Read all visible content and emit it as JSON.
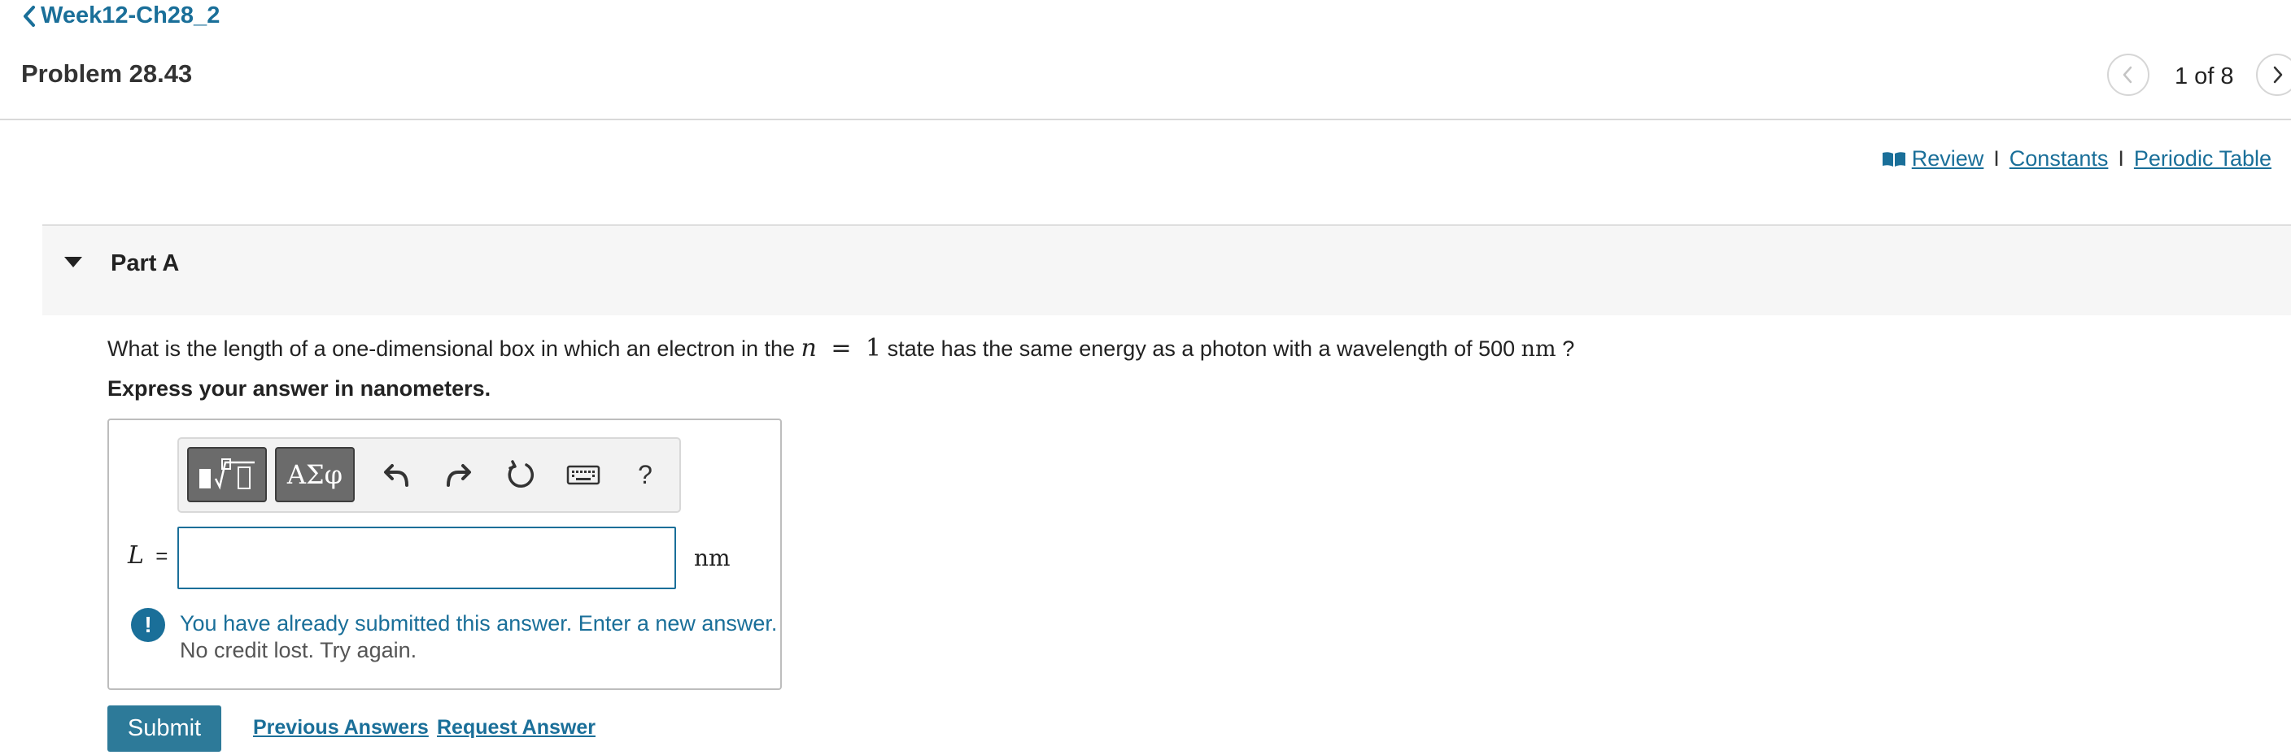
{
  "header": {
    "back_label": "Week12-Ch28_2",
    "problem_title": "Problem 28.43",
    "pager_text": "1 of 8"
  },
  "resources": {
    "review": "Review",
    "constants": "Constants",
    "periodic_table": "Periodic Table",
    "separator": "I"
  },
  "part": {
    "label": "Part A",
    "question_before": "What is the length of a one-dimensional box in which an electron in the",
    "var_n": "n",
    "equals": "=",
    "n_value": "1",
    "question_middle": "state has the same energy as a photon with a wavelength of 500",
    "wavelength_unit": "nm",
    "question_end": "?",
    "instruction": "Express your answer in nanometers."
  },
  "answer": {
    "toolbar_greek": "ΑΣφ",
    "toolbar_help": "?",
    "variable": "L",
    "equals": "=",
    "input_value": "",
    "unit": "nm",
    "alert_icon": "!",
    "alert_primary": "You have already submitted this answer. Enter a new answer.",
    "alert_secondary": "No credit lost. Try again."
  },
  "actions": {
    "submit": "Submit",
    "previous_answers": "Previous Answers",
    "request_answer": "Request Answer"
  },
  "colors": {
    "link": "#1a6f99",
    "submit_bg": "#2d7a99",
    "band_bg": "#f6f6f6",
    "toolbar_button": "#6b6b6b"
  }
}
